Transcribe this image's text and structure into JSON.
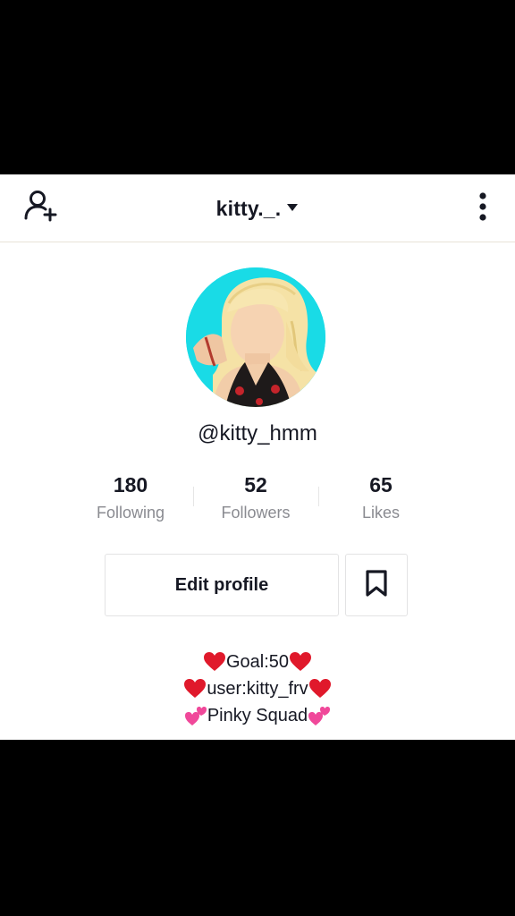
{
  "header": {
    "account_name": "kitty._."
  },
  "icons": {
    "add_user": "add-user-icon",
    "dropdown": "caret-down-icon",
    "more": "more-vertical-icon",
    "bookmark": "bookmark-icon",
    "heart": "red-heart-emoji",
    "two_hearts": "two-hearts-emoji"
  },
  "profile": {
    "username": "@kitty_hmm",
    "stats": [
      {
        "value": "180",
        "label": "Following"
      },
      {
        "value": "52",
        "label": "Followers"
      },
      {
        "value": "65",
        "label": "Likes"
      }
    ],
    "edit_profile_label": "Edit profile",
    "bio": [
      "Goal:50",
      "user:kitty_frv",
      "Pinky Squad"
    ]
  },
  "colors": {
    "text": "#161823",
    "muted": "#8a8b91",
    "avatar_bg": "#19dbe6",
    "heart_red": "#e0192b",
    "heart_pink": "#f0489a"
  }
}
